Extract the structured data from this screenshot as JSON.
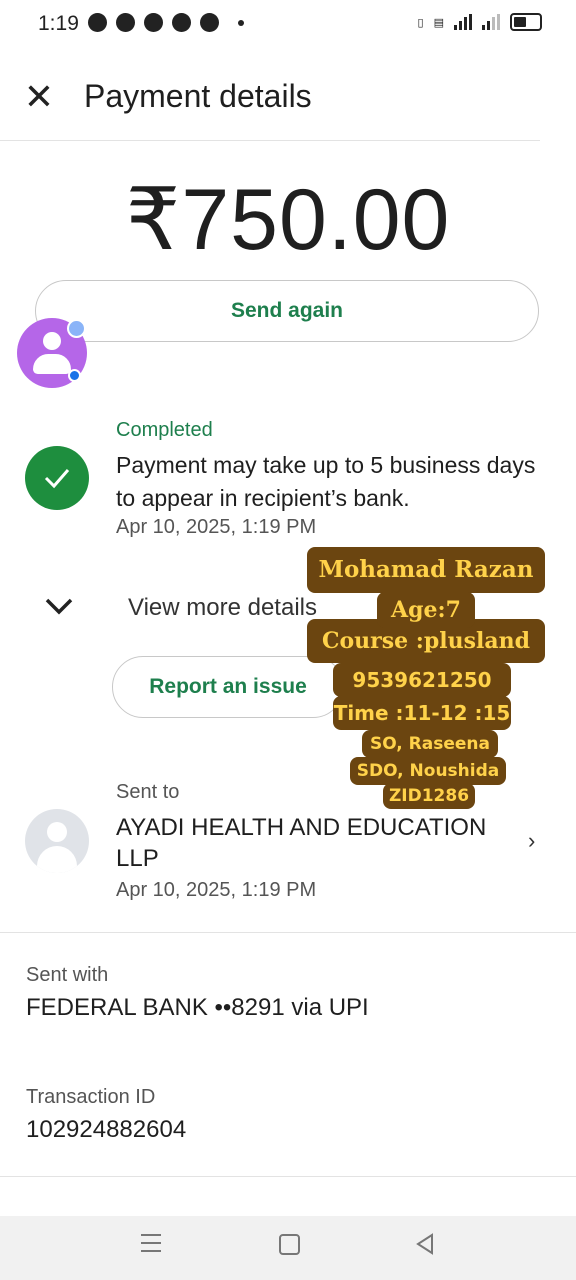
{
  "status_bar": {
    "time": "1:19"
  },
  "header": {
    "title": "Payment details"
  },
  "payment": {
    "amount": "₹750.00",
    "send_again_label": "Send again",
    "status": "Completed",
    "status_message": "Payment may take up to 5 business days to appear in recipient’s bank.",
    "status_date": "Apr 10, 2025, 1:19 PM",
    "view_more_label": "View more details",
    "report_label": "Report an issue"
  },
  "recipient": {
    "label": "Sent to",
    "name": "AYADI HEALTH AND EDUCATION LLP",
    "date": "Apr 10, 2025, 1:19 PM"
  },
  "sent_with": {
    "label": "Sent with",
    "value": "FEDERAL BANK ••8291 via UPI"
  },
  "transaction": {
    "label": "Transaction ID",
    "value": "102924882604"
  },
  "overlay": {
    "name": "Mohamad Razan",
    "age": "Age:7",
    "course": "Course :plusland",
    "phone": "9539621250",
    "time": "Time :11-12 :15",
    "so": "SO, Raseena",
    "sdo": "SDO, Noushida",
    "zid": "ZID1286"
  },
  "colors": {
    "accent_green": "#1e7f4d",
    "check_green": "#1e8e3e",
    "sticker_bg": "#6b4510",
    "sticker_text": "#ffd24a"
  }
}
